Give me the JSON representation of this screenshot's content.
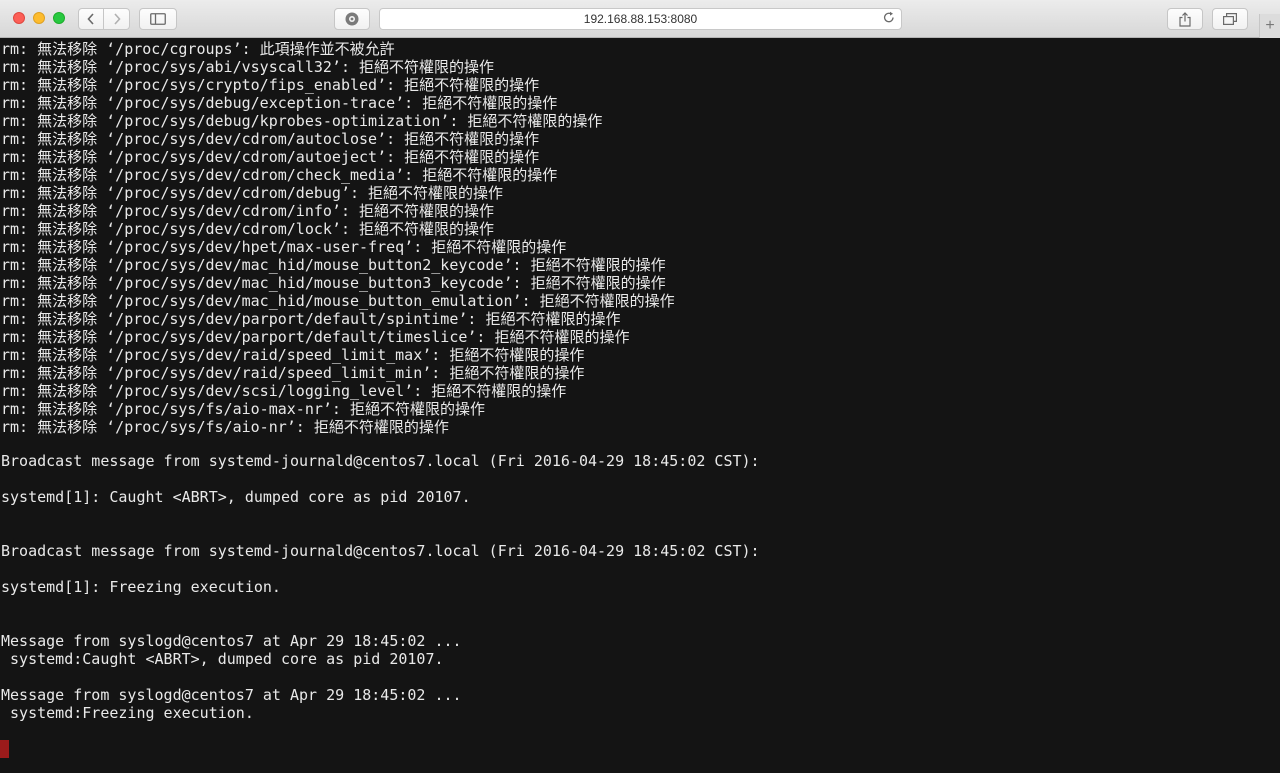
{
  "browser": {
    "url": "192.168.88.153:8080",
    "icons": {
      "back": "chevron-left-icon",
      "forward": "chevron-right-icon",
      "sidebar": "sidebar-icon",
      "site": "site-settings-icon",
      "reload": "reload-icon",
      "share": "share-icon",
      "tabs": "tabs-icon",
      "new_tab": "plus-icon"
    }
  },
  "terminal": {
    "lines": [
      "rm: 無法移除 ‘/proc/cgroups’: 此項操作並不被允許",
      "rm: 無法移除 ‘/proc/sys/abi/vsyscall32’: 拒絕不符權限的操作",
      "rm: 無法移除 ‘/proc/sys/crypto/fips_enabled’: 拒絕不符權限的操作",
      "rm: 無法移除 ‘/proc/sys/debug/exception-trace’: 拒絕不符權限的操作",
      "rm: 無法移除 ‘/proc/sys/debug/kprobes-optimization’: 拒絕不符權限的操作",
      "rm: 無法移除 ‘/proc/sys/dev/cdrom/autoclose’: 拒絕不符權限的操作",
      "rm: 無法移除 ‘/proc/sys/dev/cdrom/autoeject’: 拒絕不符權限的操作",
      "rm: 無法移除 ‘/proc/sys/dev/cdrom/check_media’: 拒絕不符權限的操作",
      "rm: 無法移除 ‘/proc/sys/dev/cdrom/debug’: 拒絕不符權限的操作",
      "rm: 無法移除 ‘/proc/sys/dev/cdrom/info’: 拒絕不符權限的操作",
      "rm: 無法移除 ‘/proc/sys/dev/cdrom/lock’: 拒絕不符權限的操作",
      "rm: 無法移除 ‘/proc/sys/dev/hpet/max-user-freq’: 拒絕不符權限的操作",
      "rm: 無法移除 ‘/proc/sys/dev/mac_hid/mouse_button2_keycode’: 拒絕不符權限的操作",
      "rm: 無法移除 ‘/proc/sys/dev/mac_hid/mouse_button3_keycode’: 拒絕不符權限的操作",
      "rm: 無法移除 ‘/proc/sys/dev/mac_hid/mouse_button_emulation’: 拒絕不符權限的操作",
      "rm: 無法移除 ‘/proc/sys/dev/parport/default/spintime’: 拒絕不符權限的操作",
      "rm: 無法移除 ‘/proc/sys/dev/parport/default/timeslice’: 拒絕不符權限的操作",
      "rm: 無法移除 ‘/proc/sys/dev/raid/speed_limit_max’: 拒絕不符權限的操作",
      "rm: 無法移除 ‘/proc/sys/dev/raid/speed_limit_min’: 拒絕不符權限的操作",
      "rm: 無法移除 ‘/proc/sys/dev/scsi/logging_level’: 拒絕不符權限的操作",
      "rm: 無法移除 ‘/proc/sys/fs/aio-max-nr’: 拒絕不符權限的操作",
      "rm: 無法移除 ‘/proc/sys/fs/aio-nr’: 拒絕不符權限的操作",
      "",
      "Broadcast message from systemd-journald@centos7.local (Fri 2016-04-29 18:45:02 CST):",
      "",
      "systemd[1]: Caught <ABRT>, dumped core as pid 20107.",
      "",
      "",
      "Broadcast message from systemd-journald@centos7.local (Fri 2016-04-29 18:45:02 CST):",
      "",
      "systemd[1]: Freezing execution.",
      "",
      "",
      "Message from syslogd@centos7 at Apr 29 18:45:02 ...",
      " systemd:Caught <ABRT>, dumped core as pid 20107.",
      "",
      "Message from syslogd@centos7 at Apr 29 18:45:02 ...",
      " systemd:Freezing execution."
    ]
  },
  "colors": {
    "terminal_bg": "#141414",
    "terminal_fg": "#e9e9e9",
    "cursor": "#9b1b1b"
  }
}
